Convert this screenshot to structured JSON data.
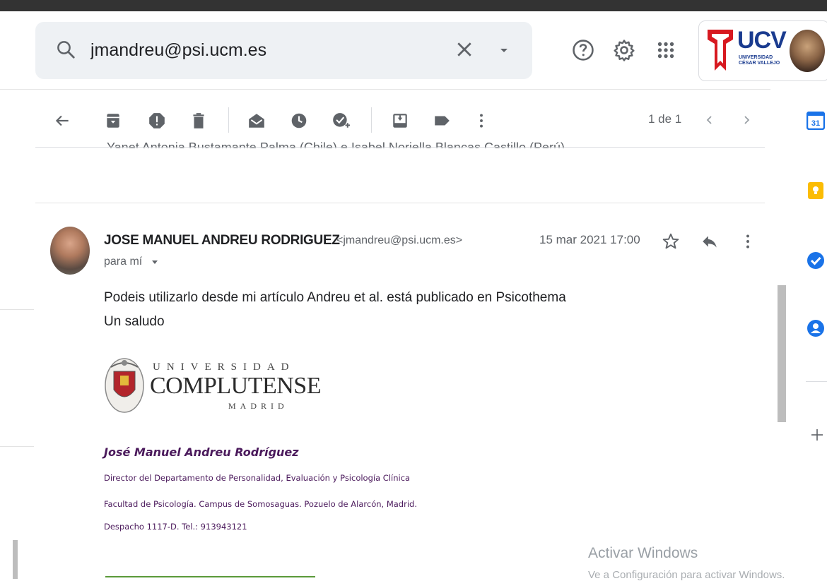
{
  "search": {
    "query": "jmandreu@psi.ucm.es"
  },
  "account": {
    "org_logo_text": "UCV",
    "org_logo_sub": [
      "UNIVERSIDAD",
      "CÉSAR VALLEJO"
    ]
  },
  "toolbar": {
    "pager": "1 de 1"
  },
  "previous_message_fragment": "Yanet Antonia Bustamante Palma (Chile) e Isabel Noriella Blancas Castillo (Perú)",
  "message": {
    "sender_name": "JOSE MANUEL ANDREU RODRIGUEZ",
    "sender_email": "<jmandreu@psi.ucm.es>",
    "to": "para mí",
    "date": "15 mar 2021 17:00",
    "body": [
      "Podeis utilizarlo desde mi artículo Andreu et al. está publicado en Psicothema",
      "Un saludo"
    ],
    "logo": {
      "line1": "UNIVERSIDAD",
      "line2": "COMPLUTENSE",
      "line3": "MADRID"
    },
    "signature": {
      "name": "José Manuel Andreu Rodríguez",
      "lines": [
        "Director del Departamento de Personalidad, Evaluación y Psicología Clínica",
        "Facultad de Psicología. Campus de Somosaguas. Pozuelo de Alarcón, Madrid.",
        "Despacho 1117-D. Tel.: 913943121"
      ]
    }
  },
  "side_panel": {
    "calendar_day": "31"
  },
  "watermark": {
    "title": "Activar Windows",
    "subtitle": "Ve a Configuración para activar Windows."
  },
  "colors": {
    "search_bg": "#eef1f4",
    "signature": "#4b1a5c",
    "calendar": "#1a73e8",
    "keep": "#fbbc04",
    "tasks": "#1a73e8",
    "contacts": "#1a73e8",
    "ucv_blue": "#1a3b8f",
    "ucv_red": "#d71920"
  },
  "icons": {
    "search": "search-icon",
    "clear": "close-icon",
    "options": "chevron-down-icon",
    "help": "help-icon",
    "settings": "gear-icon",
    "apps": "apps-grid-icon",
    "back": "arrow-left-icon",
    "archive": "archive-icon",
    "spam": "report-spam-icon",
    "delete": "trash-icon",
    "mark_unread": "mark-unread-icon",
    "snooze": "snooze-clock-icon",
    "add_task": "add-task-icon",
    "move": "move-to-icon",
    "label": "label-icon",
    "more": "more-vert-icon",
    "prev": "chevron-left-icon",
    "next": "chevron-right-icon",
    "star": "star-icon",
    "reply": "reply-icon"
  }
}
